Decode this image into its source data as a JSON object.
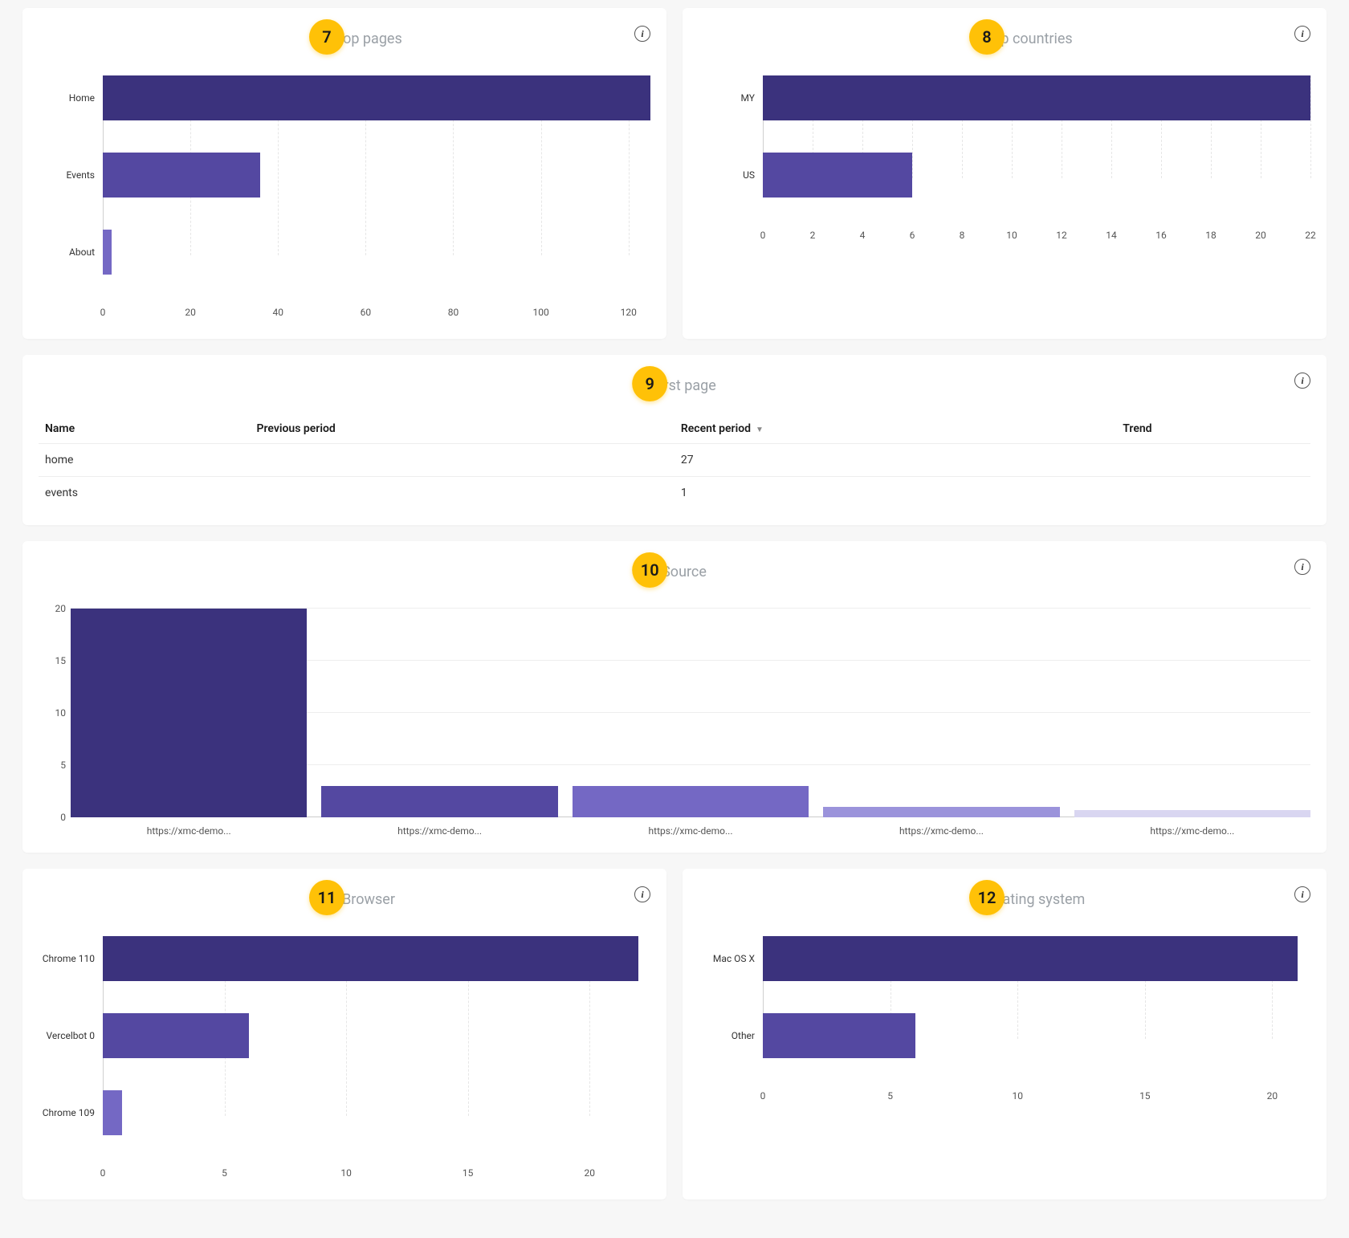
{
  "colors": [
    "#3b327d",
    "#5448a1",
    "#7468c4",
    "#9b93db",
    "#d9d6f1"
  ],
  "panels": {
    "top_pages": {
      "badge": "7",
      "title": "Top pages"
    },
    "top_countries": {
      "badge": "8",
      "title": "Top countries"
    },
    "first_page": {
      "badge": "9",
      "title": "First page"
    },
    "source": {
      "badge": "10",
      "title": "Source"
    },
    "browser": {
      "badge": "11",
      "title": "Browser"
    },
    "os": {
      "badge": "12",
      "title": "Operating system"
    }
  },
  "first_page_table": {
    "columns": [
      "Name",
      "Previous period",
      "Recent period",
      "Trend"
    ],
    "sort_col": 2,
    "rows": [
      {
        "name": "home",
        "previous": "",
        "recent": "27",
        "trend": ""
      },
      {
        "name": "events",
        "previous": "",
        "recent": "1",
        "trend": ""
      }
    ]
  },
  "chart_data": [
    {
      "id": "top_pages",
      "type": "bar",
      "orientation": "horizontal",
      "categories": [
        "Home",
        "Events",
        "About"
      ],
      "values": [
        125,
        36,
        2
      ],
      "xlim": [
        0,
        125
      ],
      "xticks": [
        0,
        20,
        40,
        60,
        80,
        100,
        120
      ]
    },
    {
      "id": "top_countries",
      "type": "bar",
      "orientation": "horizontal",
      "categories": [
        "MY",
        "US"
      ],
      "values": [
        22,
        6
      ],
      "xlim": [
        0,
        22
      ],
      "xticks": [
        0,
        2,
        4,
        6,
        8,
        10,
        12,
        14,
        16,
        18,
        20,
        22
      ]
    },
    {
      "id": "source",
      "type": "bar",
      "orientation": "vertical",
      "categories": [
        "https://xmc-demo...",
        "https://xmc-demo...",
        "https://xmc-demo...",
        "https://xmc-demo...",
        "https://xmc-demo..."
      ],
      "values": [
        20,
        3,
        3,
        1,
        0.7
      ],
      "ylim": [
        0,
        20
      ],
      "yticks": [
        0,
        5,
        10,
        15,
        20
      ]
    },
    {
      "id": "browser",
      "type": "bar",
      "orientation": "horizontal",
      "categories": [
        "Chrome 110",
        "Vercelbot 0",
        "Chrome 109"
      ],
      "values": [
        22,
        6,
        0.8
      ],
      "xlim": [
        0,
        22.5
      ],
      "xticks": [
        0,
        5,
        10,
        15,
        20
      ]
    },
    {
      "id": "os",
      "type": "bar",
      "orientation": "horizontal",
      "categories": [
        "Mac OS X",
        "Other"
      ],
      "values": [
        21,
        6
      ],
      "xlim": [
        0,
        21.5
      ],
      "xticks": [
        0,
        5,
        10,
        15,
        20
      ]
    }
  ]
}
